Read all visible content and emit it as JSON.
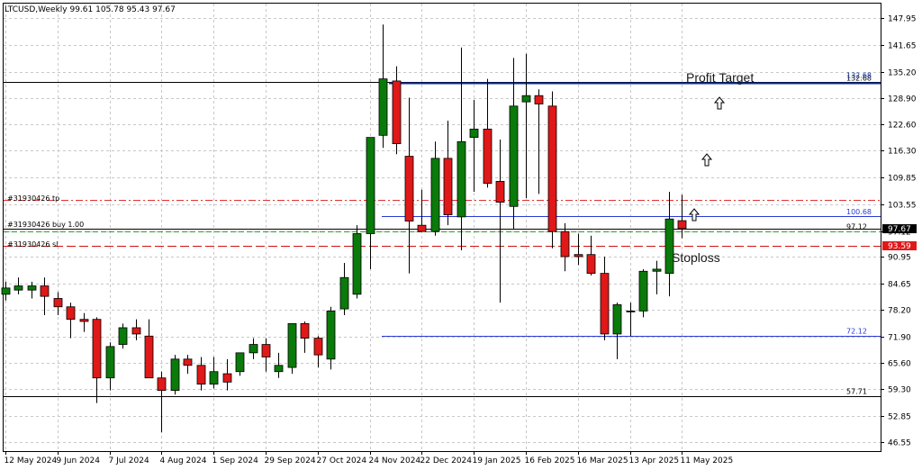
{
  "header": {
    "symbol_info": "LTCUSD,Weekly  99.61 105.78 95.43 97.67"
  },
  "annotations": {
    "profit_target": "Profit Target",
    "stoploss": "Stoploss"
  },
  "order_labels": {
    "tp": "#31930426 tp",
    "buy": "#31930426 buy 1.00",
    "sl": "#31930426 sl"
  },
  "price_tags": {
    "upper_black": "132.68",
    "upper_blue": "132.68",
    "level_100": "100.68",
    "level_97": "97.12",
    "current": "97.67",
    "sl": "93.59",
    "level_72": "72.12",
    "level_57": "57.71"
  },
  "colors": {
    "bull": "#0a7a0a",
    "bear": "#e01818",
    "blue_line": "#2a3ad6",
    "tp_line": "#e03030",
    "buy_line": "#2aa02a",
    "grid": "#c8c8c8"
  },
  "chart_data": {
    "type": "candlestick",
    "title": "LTCUSD,Weekly",
    "ylim": [
      44.5,
      151.5
    ],
    "y_ticks": [
      "147.95",
      "141.65",
      "135.20",
      "128.90",
      "122.60",
      "116.30",
      "109.85",
      "103.55",
      "97.12",
      "90.95",
      "84.65",
      "78.20",
      "71.90",
      "65.60",
      "59.30",
      "52.85",
      "46.55"
    ],
    "x_ticks": [
      "12 May 2024",
      "9 Jun 2024",
      "7 Jul 2024",
      "4 Aug 2024",
      "1 Sep 2024",
      "29 Sep 2024",
      "27 Oct 2024",
      "24 Nov 2024",
      "22 Dec 2024",
      "19 Jan 2025",
      "16 Feb 2025",
      "16 Mar 2025",
      "13 Apr 2025",
      "11 May 2025"
    ],
    "candles": [
      {
        "o": 82.0,
        "h": 85.0,
        "l": 80.5,
        "c": 83.5
      },
      {
        "o": 83.0,
        "h": 86.0,
        "l": 82.0,
        "c": 84.0
      },
      {
        "o": 83.0,
        "h": 85.0,
        "l": 81.0,
        "c": 84.0
      },
      {
        "o": 84.0,
        "h": 86.0,
        "l": 77.0,
        "c": 81.5
      },
      {
        "o": 81.0,
        "h": 82.5,
        "l": 77.0,
        "c": 79.0
      },
      {
        "o": 79.0,
        "h": 80.0,
        "l": 71.5,
        "c": 76.0
      },
      {
        "o": 76.0,
        "h": 77.5,
        "l": 73.0,
        "c": 75.5
      },
      {
        "o": 76.0,
        "h": 76.5,
        "l": 56.0,
        "c": 62.0
      },
      {
        "o": 62.0,
        "h": 70.5,
        "l": 59.0,
        "c": 69.5
      },
      {
        "o": 70.0,
        "h": 75.0,
        "l": 69.0,
        "c": 74.0
      },
      {
        "o": 74.0,
        "h": 76.0,
        "l": 71.0,
        "c": 72.5
      },
      {
        "o": 72.0,
        "h": 76.0,
        "l": 62.0,
        "c": 62.0
      },
      {
        "o": 62.0,
        "h": 63.5,
        "l": 49.0,
        "c": 59.0
      },
      {
        "o": 59.0,
        "h": 67.5,
        "l": 58.0,
        "c": 66.5
      },
      {
        "o": 66.5,
        "h": 67.5,
        "l": 63.0,
        "c": 65.0
      },
      {
        "o": 65.0,
        "h": 67.0,
        "l": 59.0,
        "c": 60.5
      },
      {
        "o": 60.5,
        "h": 67.0,
        "l": 59.5,
        "c": 63.5
      },
      {
        "o": 63.0,
        "h": 66.5,
        "l": 59.0,
        "c": 61.0
      },
      {
        "o": 63.5,
        "h": 68.0,
        "l": 62.5,
        "c": 68.0
      },
      {
        "o": 68.0,
        "h": 71.5,
        "l": 66.5,
        "c": 70.0
      },
      {
        "o": 70.0,
        "h": 71.5,
        "l": 63.5,
        "c": 67.0
      },
      {
        "o": 63.5,
        "h": 68.0,
        "l": 62.0,
        "c": 65.0
      },
      {
        "o": 64.5,
        "h": 75.0,
        "l": 63.0,
        "c": 75.0
      },
      {
        "o": 75.0,
        "h": 75.5,
        "l": 68.0,
        "c": 71.5
      },
      {
        "o": 71.5,
        "h": 72.0,
        "l": 64.5,
        "c": 67.5
      },
      {
        "o": 66.5,
        "h": 79.0,
        "l": 64.0,
        "c": 78.0
      },
      {
        "o": 78.5,
        "h": 89.5,
        "l": 77.0,
        "c": 86.0
      },
      {
        "o": 82.0,
        "h": 98.5,
        "l": 81.0,
        "c": 96.5
      },
      {
        "o": 96.5,
        "h": 112.0,
        "l": 88.0,
        "c": 119.5
      },
      {
        "o": 120.0,
        "h": 146.5,
        "l": 117.0,
        "c": 133.5
      },
      {
        "o": 133.0,
        "h": 136.5,
        "l": 115.5,
        "c": 118.0
      },
      {
        "o": 115.0,
        "h": 129.0,
        "l": 87.0,
        "c": 99.5
      },
      {
        "o": 98.5,
        "h": 107.0,
        "l": 97.5,
        "c": 97.0
      },
      {
        "o": 97.0,
        "h": 118.5,
        "l": 96.0,
        "c": 114.5
      },
      {
        "o": 114.5,
        "h": 123.5,
        "l": 98.5,
        "c": 101.0
      },
      {
        "o": 100.5,
        "h": 141.0,
        "l": 92.5,
        "c": 118.5
      },
      {
        "o": 119.5,
        "h": 128.5,
        "l": 106.5,
        "c": 121.5
      },
      {
        "o": 121.5,
        "h": 133.5,
        "l": 107.5,
        "c": 108.5
      },
      {
        "o": 109.0,
        "h": 119.0,
        "l": 80.0,
        "c": 104.0
      },
      {
        "o": 103.0,
        "h": 138.5,
        "l": 97.5,
        "c": 127.0
      },
      {
        "o": 128.0,
        "h": 139.5,
        "l": 105.0,
        "c": 129.5
      },
      {
        "o": 129.5,
        "h": 131.0,
        "l": 106.0,
        "c": 127.5
      },
      {
        "o": 127.0,
        "h": 130.5,
        "l": 93.0,
        "c": 97.0
      },
      {
        "o": 97.0,
        "h": 99.0,
        "l": 87.5,
        "c": 91.0
      },
      {
        "o": 91.5,
        "h": 96.5,
        "l": 89.0,
        "c": 91.0
      },
      {
        "o": 91.5,
        "h": 96.0,
        "l": 86.5,
        "c": 87.0
      },
      {
        "o": 87.0,
        "h": 91.0,
        "l": 71.0,
        "c": 72.5
      },
      {
        "o": 72.5,
        "h": 80.0,
        "l": 66.5,
        "c": 79.5
      },
      {
        "o": 78.0,
        "h": 80.0,
        "l": 72.0,
        "c": 78.0
      },
      {
        "o": 78.0,
        "h": 88.0,
        "l": 76.5,
        "c": 87.5
      },
      {
        "o": 87.5,
        "h": 90.0,
        "l": 82.0,
        "c": 88.0
      },
      {
        "o": 87.0,
        "h": 106.5,
        "l": 81.5,
        "c": 100.0
      },
      {
        "o": 99.6,
        "h": 105.8,
        "l": 95.4,
        "c": 97.7
      }
    ]
  }
}
